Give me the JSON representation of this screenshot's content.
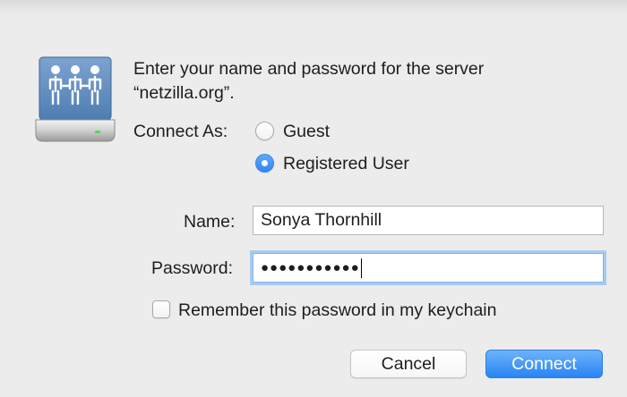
{
  "message": {
    "line1": "Enter your name and password for the server",
    "line2": "“netzilla.org”."
  },
  "connect_as": {
    "label": "Connect As:",
    "options": [
      {
        "label": "Guest",
        "selected": false
      },
      {
        "label": "Registered User",
        "selected": true
      }
    ]
  },
  "form": {
    "name_label": "Name:",
    "name_value": "Sonya Thornhill",
    "password_label": "Password:",
    "password_masked": "●●●●●●●●●●●"
  },
  "keychain": {
    "label": "Remember this password in my keychain",
    "checked": false
  },
  "buttons": {
    "cancel": "Cancel",
    "connect": "Connect"
  },
  "icon": {
    "name": "shared-server-icon"
  },
  "colors": {
    "accent": "#2f86f4",
    "focus_ring": "#a7cbf1",
    "background": "#ececec"
  }
}
